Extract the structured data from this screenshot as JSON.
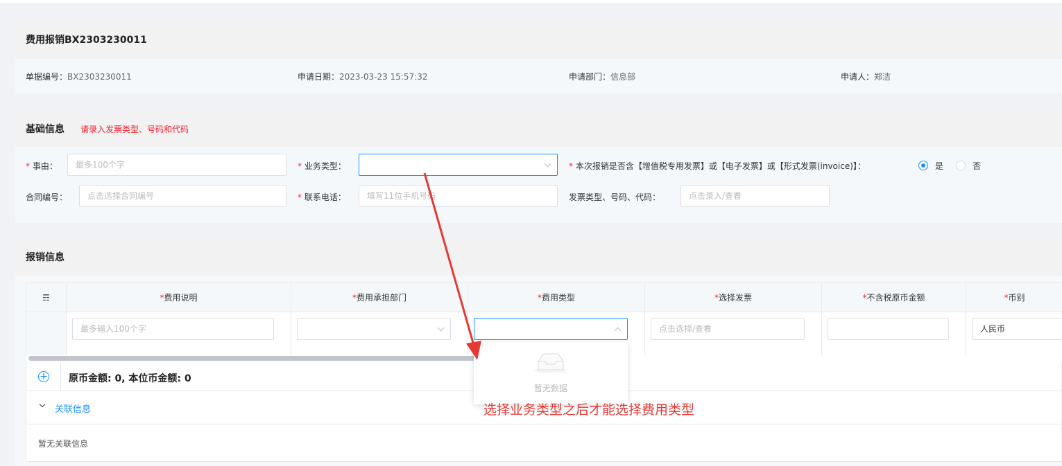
{
  "header": {
    "title": "费用报销BX2303230011",
    "meta": [
      {
        "label": "单据编号：",
        "value": "BX2303230011"
      },
      {
        "label": "申请日期：",
        "value": "2023-03-23 15:57:32"
      },
      {
        "label": "申请部门：",
        "value": "信息部"
      },
      {
        "label": "申请人：",
        "value": "郑洁"
      }
    ]
  },
  "basic": {
    "title": "基础信息",
    "note": "请录入发票类型、号码和代码",
    "reason": {
      "label": "事由：",
      "placeholder": "最多100个字"
    },
    "biz_type": {
      "label": "业务类型："
    },
    "invoice_q": {
      "label": "本次报销是否含【增值税专用发票】或【电子发票】或【形式发票(invoice)】：",
      "yes": "是",
      "no": "否"
    },
    "contract": {
      "label": "合同编号：",
      "placeholder": "点击选择合同编号"
    },
    "phone": {
      "label": "联系电话：",
      "placeholder": "填写11位手机号码"
    },
    "invoice_info": {
      "label": "发票类型、号码、代码：",
      "placeholder": "点击录入/查看"
    }
  },
  "reimb": {
    "title": "报销信息",
    "columns": [
      "费用说明",
      "费用承担部门",
      "费用类型",
      "选择发票",
      "不含税原币金额",
      "币别"
    ],
    "row": {
      "desc_placeholder": "最多输入100个字",
      "invoice_placeholder": "点击选择/查看",
      "currency": "人民币"
    },
    "empty_text": "暂无数据",
    "summary": "原币金额: 0, 本位币金额: 0",
    "related_title": "关联信息",
    "related_empty": "暂无关联信息"
  },
  "annotation": {
    "text": "选择业务类型之后才能选择费用类型",
    "color": "#e53935"
  },
  "colors": {
    "accent": "#1890ff",
    "required": "#f5222d"
  }
}
